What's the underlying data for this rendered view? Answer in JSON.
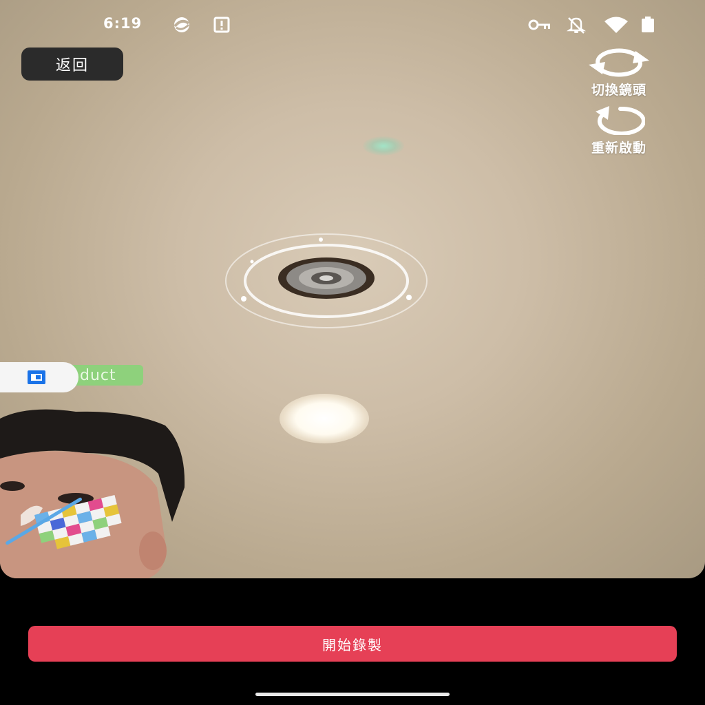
{
  "status_bar": {
    "time": "6:19",
    "left_icons": [
      "sync-app-icon",
      "alert-notification-icon"
    ],
    "right_icons": [
      "vpn-key-icon",
      "bell-muted-icon",
      "wifi-icon",
      "battery-icon"
    ]
  },
  "header": {
    "back_label": "返回"
  },
  "tools": {
    "switch_camera_label": "切換鏡頭",
    "switch_camera_icon": "rotate-camera-icon",
    "restart_label": "重新啟動",
    "restart_icon": "restart-icon"
  },
  "floating_widget": {
    "text": "duct",
    "icon": "recorder-icon",
    "accent": "#8ed17c"
  },
  "footer": {
    "record_label": "開始錄製",
    "record_color": "#e64056"
  }
}
